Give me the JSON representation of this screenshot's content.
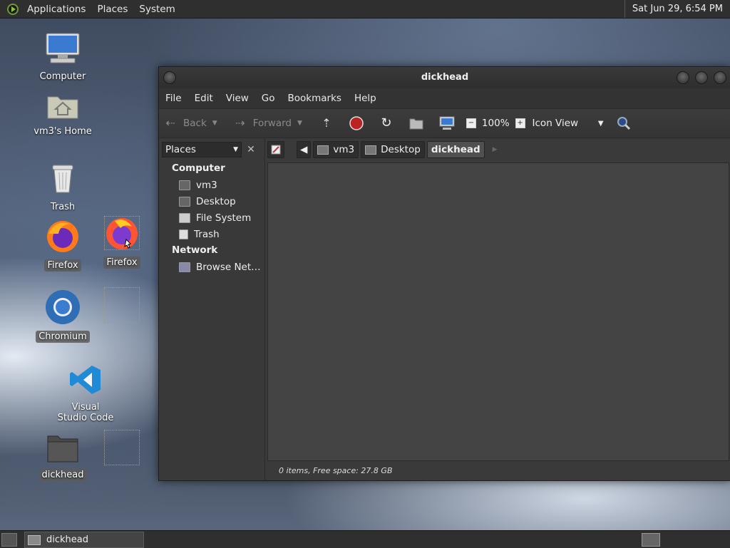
{
  "top_panel": {
    "menus": [
      "Applications",
      "Places",
      "System"
    ],
    "clock": "Sat Jun 29,  6:54 PM"
  },
  "desktop": {
    "icons": [
      {
        "label": "Computer",
        "icon": "computer-icon"
      },
      {
        "label": "vm3's Home",
        "icon": "home-folder-icon"
      },
      {
        "label": "Trash",
        "icon": "trash-icon"
      },
      {
        "label": "Firefox",
        "icon": "firefox-icon"
      },
      {
        "label": "Firefox",
        "icon": "firefox-icon"
      },
      {
        "label": "Chromium",
        "icon": "chromium-icon"
      },
      {
        "label": "Visual Studio Code",
        "icon": "vscode-icon"
      },
      {
        "label": "dickhead",
        "icon": "folder-icon"
      }
    ]
  },
  "window": {
    "title": "dickhead",
    "menus": [
      "File",
      "Edit",
      "View",
      "Go",
      "Bookmarks",
      "Help"
    ],
    "toolbar": {
      "back": "Back",
      "forward": "Forward",
      "zoom": "100%",
      "view_mode": "Icon View"
    },
    "sidebar": {
      "selector": "Places",
      "sections": [
        {
          "title": "Computer",
          "items": [
            "vm3",
            "Desktop",
            "File System",
            "Trash"
          ]
        },
        {
          "title": "Network",
          "items": [
            "Browse Net…"
          ]
        }
      ]
    },
    "path": [
      "vm3",
      "Desktop",
      "dickhead"
    ],
    "status": "0 items, Free space: 27.8 GB"
  },
  "taskbar": {
    "task": "dickhead"
  }
}
